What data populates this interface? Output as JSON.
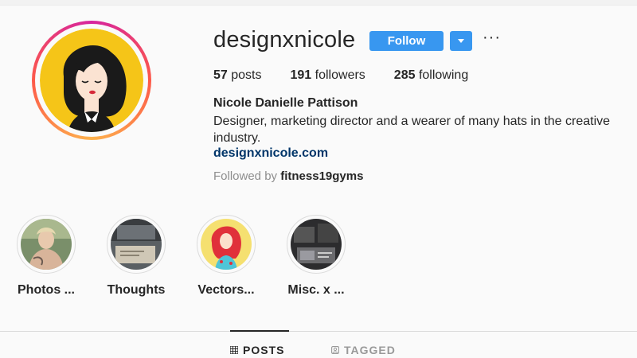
{
  "profile": {
    "username": "designxnicole",
    "follow_label": "Follow",
    "more_label": "···",
    "stats": {
      "posts_count": "57",
      "posts_label": "posts",
      "followers_count": "191",
      "followers_label": "followers",
      "following_count": "285",
      "following_label": "following"
    },
    "full_name": "Nicole Danielle Pattison",
    "bio": "Designer, marketing director and a wearer of many hats in the creative industry.",
    "website": "designxnicole.com",
    "followed_by_prefix": "Followed by ",
    "followed_by_user": "fitness19gyms"
  },
  "highlights": [
    {
      "label": "Photos ..."
    },
    {
      "label": "Thoughts"
    },
    {
      "label": "Vectors..."
    },
    {
      "label": "Misc. x ..."
    }
  ],
  "tabs": {
    "posts_label": "POSTS",
    "tagged_label": "TAGGED"
  },
  "colors": {
    "accent": "#3897f0",
    "link": "#003569",
    "avatar_bg": "#f5c518"
  }
}
